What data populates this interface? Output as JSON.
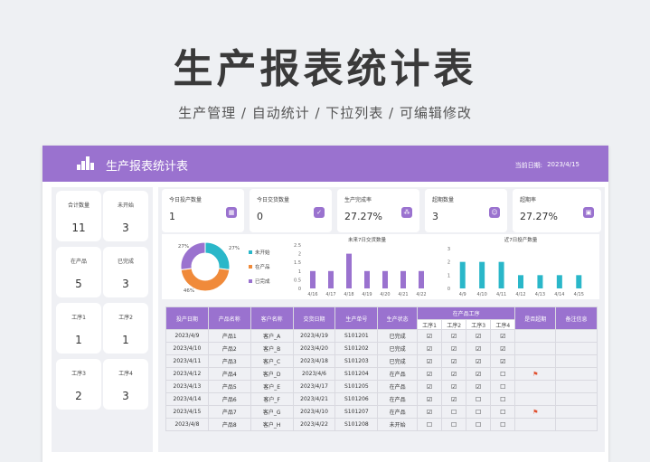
{
  "hero": {
    "title": "生产报表统计表",
    "subtitle": "生产管理 / 自动统计 / 下拉列表 / 可编辑修改"
  },
  "header": {
    "title": "生产报表统计表",
    "date_label": "当前日期:",
    "date_value": "2023/4/15",
    "bg_color": "#9a72cf"
  },
  "left_kpis": [
    {
      "label": "合计数量",
      "value": "11"
    },
    {
      "label": "未开始",
      "value": "3"
    },
    {
      "label": "在产品",
      "value": "5"
    },
    {
      "label": "已完成",
      "value": "3"
    },
    {
      "label": "工序1",
      "value": "1"
    },
    {
      "label": "工序2",
      "value": "1"
    },
    {
      "label": "工序3",
      "value": "2"
    },
    {
      "label": "工序4",
      "value": "3"
    }
  ],
  "stats": [
    {
      "label": "今日投产数量",
      "value": "1",
      "icon": "grid-icon"
    },
    {
      "label": "今日交货数量",
      "value": "0",
      "icon": "check-badge-icon"
    },
    {
      "label": "生产完成率",
      "value": "27.27%",
      "icon": "network-icon"
    },
    {
      "label": "超期数量",
      "value": "3",
      "icon": "people-icon"
    },
    {
      "label": "超期率",
      "value": "27.27%",
      "icon": "image-icon"
    }
  ],
  "chart_data": [
    {
      "type": "pie",
      "slices": [
        {
          "name": "未开始",
          "value": 27,
          "color": "#2ab7c9"
        },
        {
          "name": "在产品",
          "value": 46,
          "color": "#f08a3a"
        },
        {
          "name": "已完成",
          "value": 27,
          "color": "#9a72cf"
        }
      ],
      "data_labels": [
        "27%",
        "27%",
        "46%"
      ],
      "legend_placement": "right"
    },
    {
      "type": "bar",
      "title": "未来7日交货数量",
      "categories": [
        "4/16",
        "4/17",
        "4/18",
        "4/19",
        "4/20",
        "4/21",
        "4/22"
      ],
      "values": [
        1,
        1,
        2,
        1,
        1,
        1,
        1
      ],
      "yticks": [
        "0",
        "0.5",
        "1",
        "1.5",
        "2",
        "2.5"
      ],
      "ylim": [
        0,
        2.5
      ],
      "color": "#9a72cf"
    },
    {
      "type": "bar",
      "title": "近7日投产数量",
      "categories": [
        "4/9",
        "4/10",
        "4/11",
        "4/12",
        "4/13",
        "4/14",
        "4/15"
      ],
      "values": [
        2,
        2,
        2,
        1,
        1,
        1,
        1
      ],
      "yticks": [
        "0",
        "1",
        "2",
        "3"
      ],
      "ylim": [
        0,
        3
      ],
      "color": "#2ab7c9"
    }
  ],
  "table": {
    "headers": [
      "投产日期",
      "产品名称",
      "客户名称",
      "交货日期",
      "生产单号",
      "生产状态",
      "在产品工序",
      "是否超期",
      "备注信息"
    ],
    "sub_headers": [
      "工序1",
      "工序2",
      "工序3",
      "工序4"
    ],
    "rows": [
      [
        "2023/4/9",
        "产品1",
        "客户_A",
        "2023/4/19",
        "S101201",
        "已完成",
        "☑",
        "☑",
        "☑",
        "☑",
        "",
        ""
      ],
      [
        "2023/4/10",
        "产品2",
        "客户_B",
        "2023/4/20",
        "S101202",
        "已完成",
        "☑",
        "☑",
        "☑",
        "☑",
        "",
        ""
      ],
      [
        "2023/4/11",
        "产品3",
        "客户_C",
        "2023/4/18",
        "S101203",
        "已完成",
        "☑",
        "☑",
        "☑",
        "☑",
        "",
        ""
      ],
      [
        "2023/4/12",
        "产品4",
        "客户_D",
        "2023/4/6",
        "S101204",
        "在产品",
        "☑",
        "☑",
        "☑",
        "☐",
        "⚑",
        ""
      ],
      [
        "2023/4/13",
        "产品5",
        "客户_E",
        "2023/4/17",
        "S101205",
        "在产品",
        "☑",
        "☑",
        "☑",
        "☐",
        "",
        ""
      ],
      [
        "2023/4/14",
        "产品6",
        "客户_F",
        "2023/4/21",
        "S101206",
        "在产品",
        "☑",
        "☑",
        "☐",
        "☐",
        "",
        ""
      ],
      [
        "2023/4/15",
        "产品7",
        "客户_G",
        "2023/4/10",
        "S101207",
        "在产品",
        "☑",
        "☐",
        "☐",
        "☐",
        "⚑",
        ""
      ],
      [
        "2023/4/8",
        "产品8",
        "客户_H",
        "2023/4/22",
        "S101208",
        "未开始",
        "☐",
        "☐",
        "☐",
        "☐",
        "",
        ""
      ]
    ]
  }
}
